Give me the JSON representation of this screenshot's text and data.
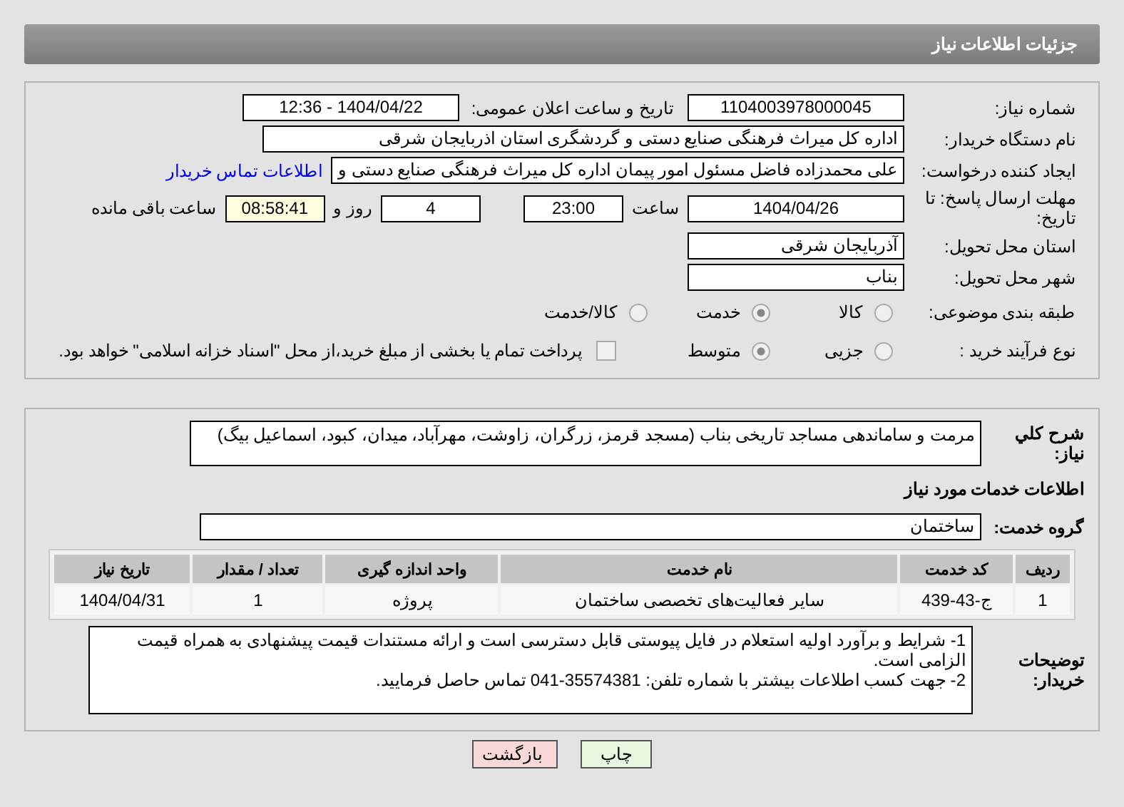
{
  "header": {
    "title": "جزئیات اطلاعات نیاز"
  },
  "need_number": {
    "label": "شماره نیاز:",
    "value": "1104003978000045"
  },
  "announce": {
    "label": "تاریخ و ساعت اعلان عمومی:",
    "value": "1404/04/22 - 12:36"
  },
  "buyer": {
    "label": "نام دستگاه خریدار:",
    "value": "اداره کل میراث فرهنگی  صنایع دستی و گردشگری استان اذربایجان شرقی"
  },
  "requester": {
    "label": "ایجاد کننده درخواست:",
    "value": "علی محمدزاده فاضل مسئول امور پیمان اداره کل میراث فرهنگی  صنایع دستی و",
    "link": "اطلاعات تماس خریدار"
  },
  "deadline": {
    "label": "مهلت ارسال پاسخ: تا تاریخ:",
    "date": "1404/04/26",
    "time_label": "ساعت",
    "time": "23:00",
    "days": "4",
    "days_label": "روز و",
    "remaining": "08:58:41",
    "remaining_label": "ساعت باقی مانده"
  },
  "province": {
    "label": "استان محل تحویل:",
    "value": "آذربایجان شرقی"
  },
  "city": {
    "label": "شهر محل تحویل:",
    "value": "بناب"
  },
  "category": {
    "label": "طبقه بندی موضوعی:",
    "options": [
      {
        "label": "کالا",
        "selected": false
      },
      {
        "label": "خدمت",
        "selected": true
      },
      {
        "label": "کالا/خدمت",
        "selected": false
      }
    ]
  },
  "process": {
    "label": "نوع فرآیند خرید :",
    "options": [
      {
        "label": "جزیی",
        "selected": false
      },
      {
        "label": "متوسط",
        "selected": true
      }
    ],
    "payment": {
      "label": "پرداخت تمام یا بخشی از مبلغ خرید،از محل \"اسناد خزانه اسلامی\" خواهد بود.",
      "checked": false
    }
  },
  "description": {
    "label": "شرح کلي نياز:",
    "value": "مرمت و ساماندهی مساجد تاریخی بناب (مسجد قرمز، زرگران، زاوشت، مهرآباد، میدان، کبود، اسماعیل بیگ)"
  },
  "services_heading": "اطلاعات خدمات مورد نیاز",
  "service_group": {
    "label": "گروه خدمت:",
    "value": "ساختمان"
  },
  "table": {
    "columns": [
      "ردیف",
      "کد خدمت",
      "نام خدمت",
      "واحد اندازه گیری",
      "تعداد / مقدار",
      "تاریخ نیاز"
    ],
    "rows": [
      [
        "1",
        "ج-43-439",
        "سایر فعالیت‌های تخصصی ساختمان",
        "پروژه",
        "1",
        "1404/04/31"
      ]
    ]
  },
  "notes": {
    "label": "توضیحات خریدار:",
    "lines": [
      "1- شرایط و برآورد اولیه استعلام در فایل پیوستی قابل دسترسی است و ارائه مستندات قیمت پیشنهادی به همراه قیمت الزامی است.",
      "2- جهت کسب اطلاعات بیشتر  با شماره تلفن: 35574381-041  تماس حاصل فرمایید."
    ]
  },
  "buttons": [
    {
      "label": "چاپ",
      "kind": "print"
    },
    {
      "label": "بازگشت",
      "kind": "back"
    }
  ]
}
